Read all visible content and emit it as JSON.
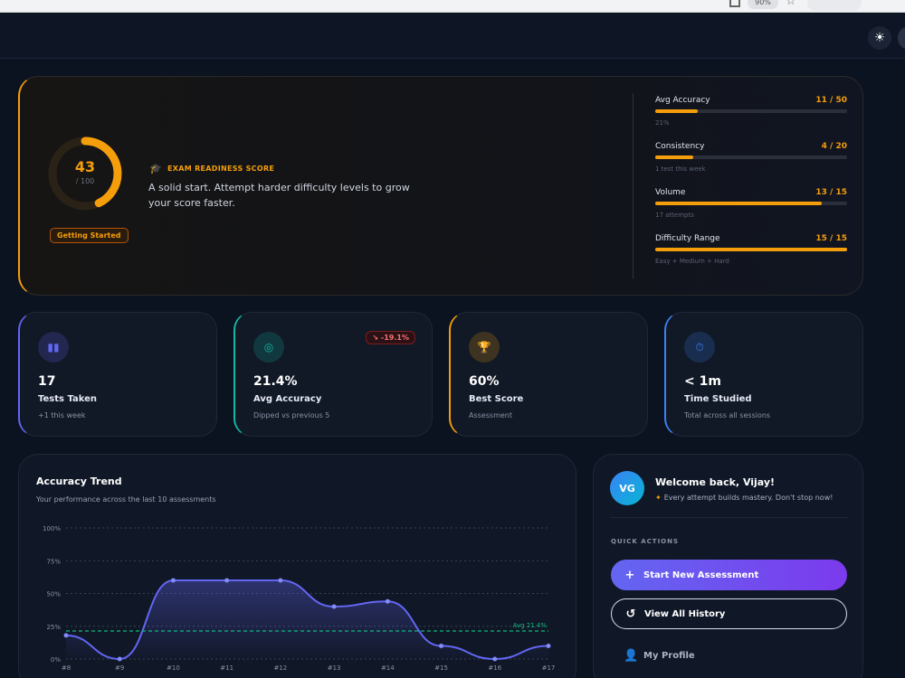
{
  "browser": {
    "zoom": "90%"
  },
  "readiness": {
    "score": "43",
    "score_max": "/ 100",
    "score_fraction": 0.43,
    "status": "Getting Started",
    "label": "EXAM READINESS SCORE",
    "description": "A solid start. Attempt harder difficulty levels to grow your score faster.",
    "metrics": [
      {
        "label": "Avg Accuracy",
        "value": "11 / 50",
        "fraction": 0.22,
        "note": "21%"
      },
      {
        "label": "Consistency",
        "value": "4 / 20",
        "fraction": 0.2,
        "note": "1 test this week"
      },
      {
        "label": "Volume",
        "value": "13 / 15",
        "fraction": 0.867,
        "note": "17 attempts"
      },
      {
        "label": "Difficulty Range",
        "value": "15 / 15",
        "fraction": 1.0,
        "note": "Easy + Medium + Hard"
      }
    ]
  },
  "stats": [
    {
      "value": "17",
      "label": "Tests Taken",
      "sub": "+1 this week",
      "accent": "#6366f1",
      "icon": "chart-icon"
    },
    {
      "value": "21.4%",
      "label": "Avg Accuracy",
      "sub": "Dipped vs previous 5",
      "accent": "#14b8a6",
      "icon": "target-icon",
      "badge": "-19.1%"
    },
    {
      "value": "60%",
      "label": "Best Score",
      "sub": "Assessment",
      "accent": "#f59e0b",
      "icon": "trophy-icon"
    },
    {
      "value": "< 1m",
      "label": "Time Studied",
      "sub": "Total across all sessions",
      "accent": "#3b82f6",
      "icon": "stopwatch-icon"
    }
  ],
  "trend": {
    "title": "Accuracy Trend",
    "subtitle": "Your performance across the last 10 assessments"
  },
  "chart_data": {
    "type": "area",
    "title": "Accuracy Trend",
    "categories": [
      "#8",
      "#9",
      "#10",
      "#11",
      "#12",
      "#13",
      "#14",
      "#15",
      "#16",
      "#17"
    ],
    "series": [
      {
        "values": [
          18,
          0,
          60,
          60,
          60,
          40,
          44,
          10,
          0,
          10
        ]
      }
    ],
    "yticks": [
      "0%",
      "25%",
      "50%",
      "75%",
      "100%"
    ],
    "ylim": [
      0,
      100
    ],
    "reference_line": {
      "value": 21.4,
      "label": "Avg 21.4%"
    },
    "grid": true
  },
  "welcome": {
    "initials": "VG",
    "title": "Welcome back, Vijay!",
    "subtitle": "Every attempt builds mastery. Don't stop now!",
    "quick_actions_label": "QUICK ACTIONS",
    "start_label": "Start New Assessment",
    "history_label": "View All History",
    "profile_label": "My Profile"
  }
}
